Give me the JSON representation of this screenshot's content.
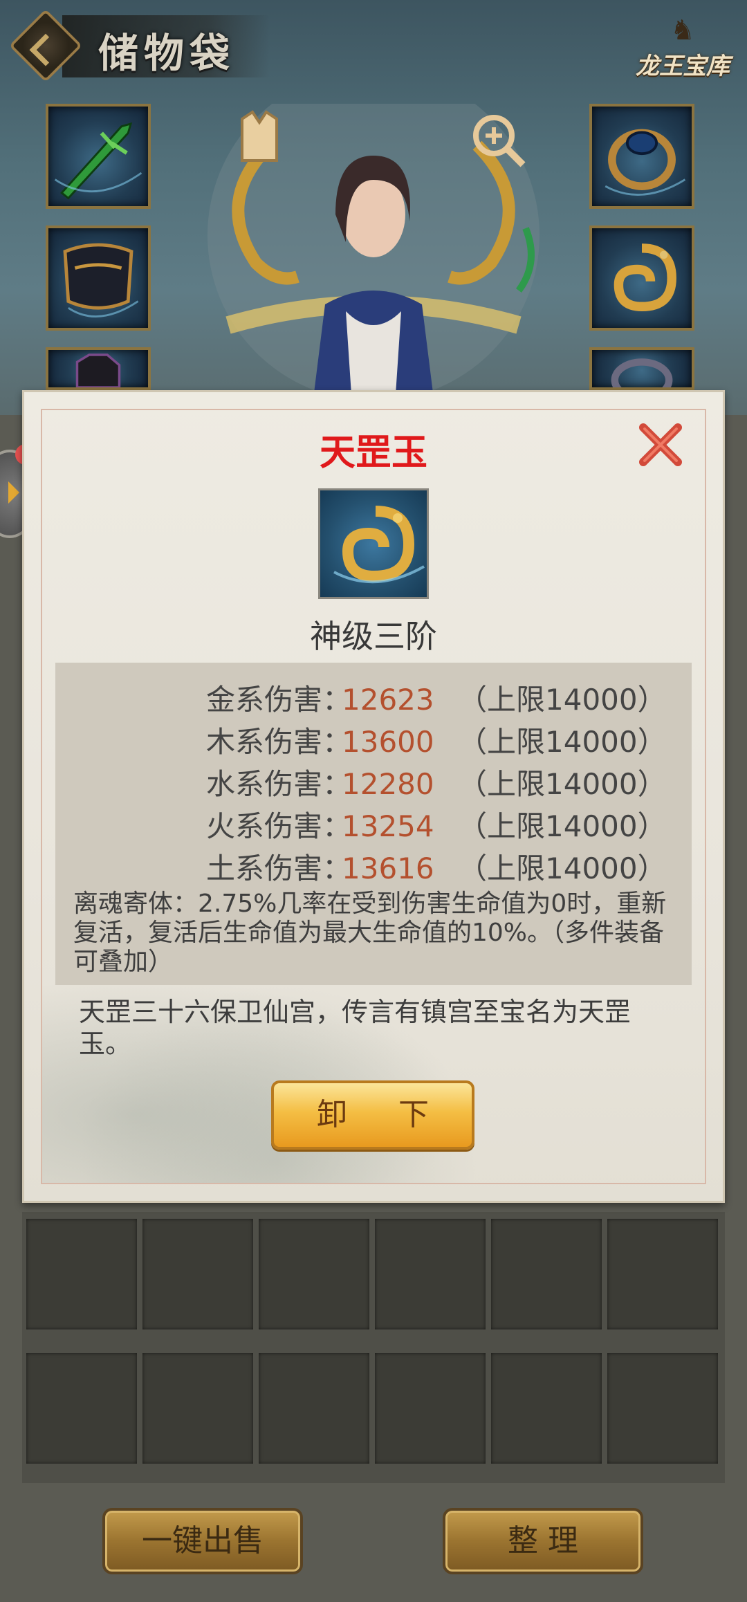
{
  "header": {
    "title": "储物袋",
    "logo_text": "龙王宝库"
  },
  "item": {
    "name": "天罡玉",
    "grade": "神级三阶",
    "stats": [
      {
        "label": "金系伤害：",
        "value": "12623",
        "cap": "（上限14000）"
      },
      {
        "label": "木系伤害：",
        "value": "13600",
        "cap": "（上限14000）"
      },
      {
        "label": "水系伤害：",
        "value": "12280",
        "cap": "（上限14000）"
      },
      {
        "label": "火系伤害：",
        "value": "13254",
        "cap": "（上限14000）"
      },
      {
        "label": "土系伤害：",
        "value": "13616",
        "cap": "（上限14000）"
      }
    ],
    "special": "离魂寄体：2.75%几率在受到伤害生命值为0时，重新复活，复活后生命值为最大生命值的10%。（多件装备可叠加）",
    "lore": "天罡三十六保卫仙宫，传言有镇宫至宝名为天罡玉。",
    "unequip_label": "卸 下"
  },
  "buttons": {
    "sell_all": "一键出售",
    "arrange": "整 理"
  },
  "colors": {
    "item_name": "#e0191b",
    "stat_value": "#b4502e",
    "button_gold": "#f4be44"
  }
}
